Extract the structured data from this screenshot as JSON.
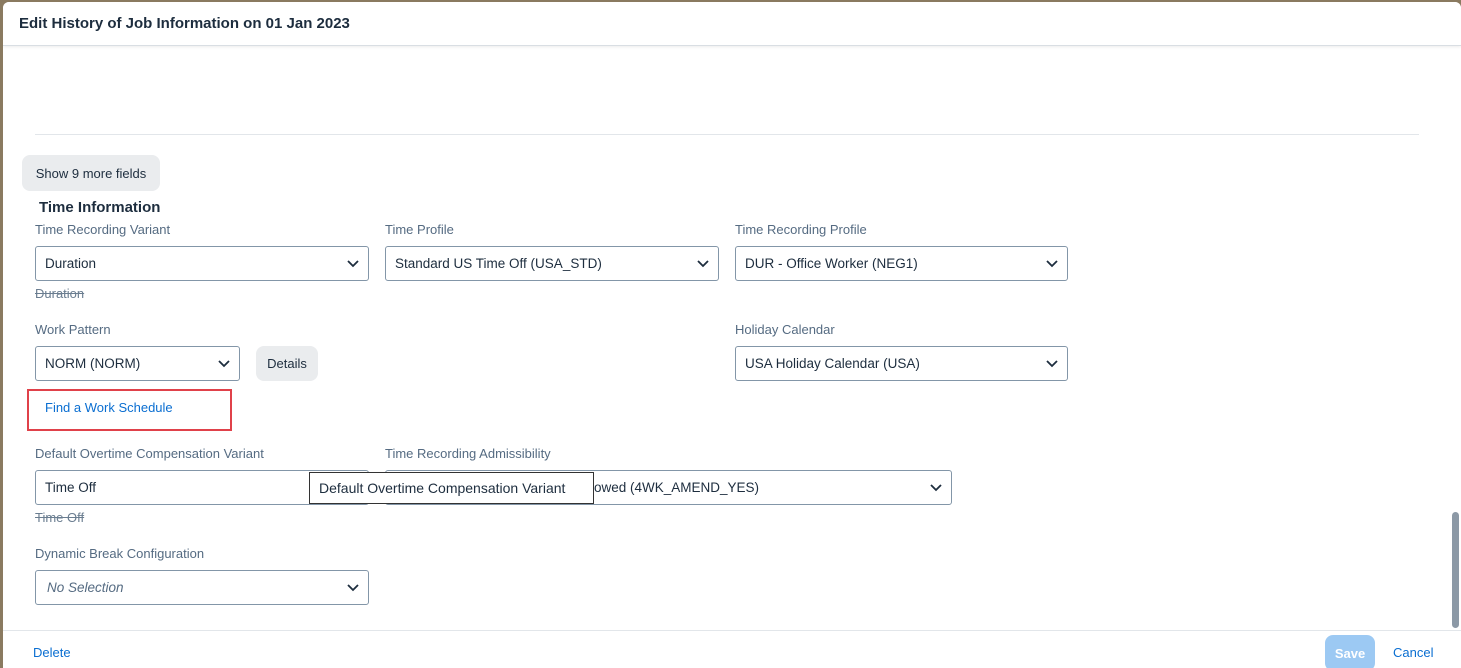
{
  "dialog": {
    "title": "Edit History of Job Information on 01 Jan 2023"
  },
  "show_more": {
    "label": "Show 9 more fields"
  },
  "section": {
    "title": "Time Information"
  },
  "fields": {
    "time_recording_variant": {
      "label": "Time Recording Variant",
      "value": "Duration",
      "previous": "Duration"
    },
    "time_profile": {
      "label": "Time Profile",
      "value": "Standard US Time Off (USA_STD)"
    },
    "time_recording_profile": {
      "label": "Time Recording Profile",
      "value": "DUR - Office Worker (NEG1)"
    },
    "work_pattern": {
      "label": "Work Pattern",
      "value": "NORM (NORM)",
      "details_label": "Details"
    },
    "holiday_calendar": {
      "label": "Holiday Calendar",
      "value": "USA Holiday Calendar (USA)"
    },
    "find_schedule": {
      "label": "Find a Work Schedule"
    },
    "default_overtime": {
      "label": "Default Overtime Compensation Variant",
      "value": "Time Off",
      "previous": "Time Off"
    },
    "time_recording_admissibility": {
      "label": "Time Recording Admissibility",
      "value_visible": "owed (4WK_AMEND_YES)"
    },
    "dynamic_break": {
      "label": "Dynamic Break Configuration",
      "value": "No Selection"
    }
  },
  "tooltip": {
    "text": "Default Overtime Compensation Variant"
  },
  "footer": {
    "delete_label": "Delete",
    "save_label": "Save",
    "cancel_label": "Cancel"
  },
  "colors": {
    "accent": "#0a6ed1",
    "highlight": "#e0414a",
    "save_disabled": "#9cc9f3"
  }
}
